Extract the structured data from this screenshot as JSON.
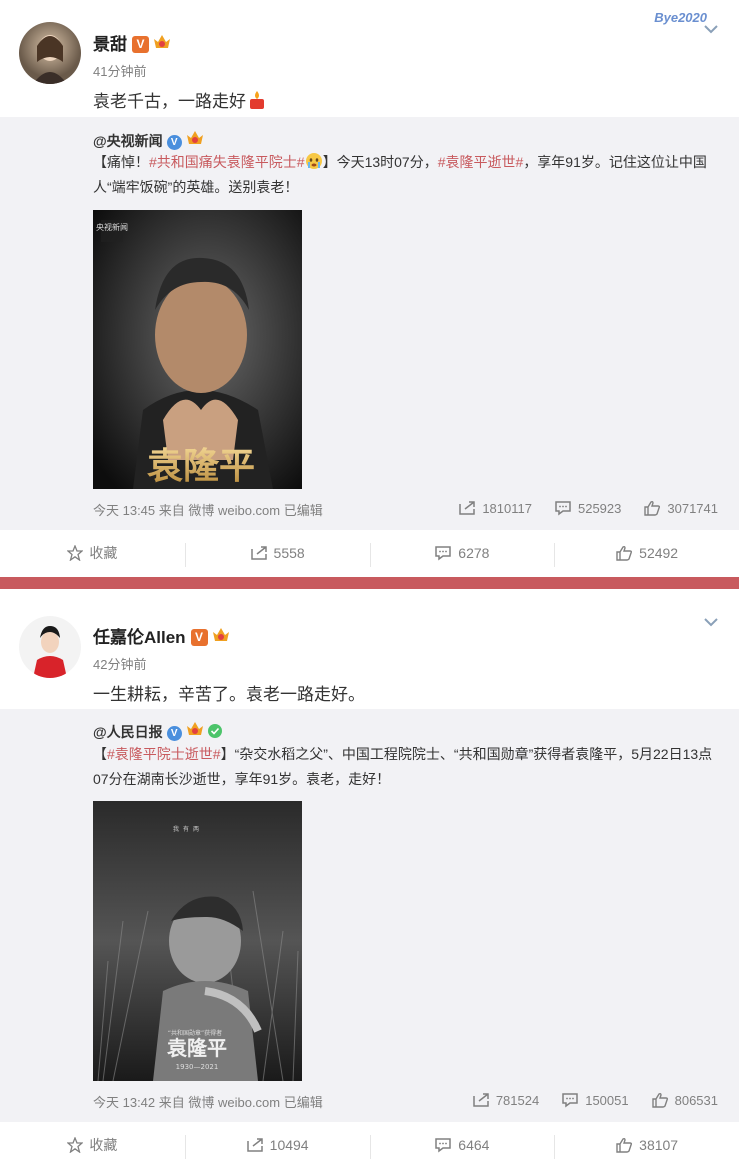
{
  "posts": [
    {
      "author": "景甜",
      "time": "41分钟前",
      "content": "袁老千古，一路走好",
      "corner_text": "Bye2020",
      "repost": {
        "author": "@央视新闻",
        "text_parts": [
          "【痛悼！",
          "#共和国痛失袁隆平院士#",
          "】今天13时07分，",
          "#袁隆平逝世#",
          "，享年91岁。记住这位让中国人“端牢饭碗”的英雄。送别袁老！"
        ],
        "image_logo": "央视新闻",
        "image_title": "袁隆平",
        "meta": "今天 13:45 来自 微博 weibo.com   已编辑",
        "reposts": "1810117",
        "comments": "525923",
        "likes": "3071741"
      },
      "actions": {
        "fav": "收藏",
        "share": "5558",
        "comment": "6278",
        "like": "52492"
      }
    },
    {
      "author": "任嘉伦Allen",
      "time": "42分钟前",
      "content": "一生耕耘，辛苦了。袁老一路走好。",
      "repost": {
        "author": "@人民日报",
        "text_parts": [
          "",
          "#袁隆平院士逝世#",
          "“杂交水稻之父”、中国工程院院士、“共和国勋章”获得者袁隆平，5月22日13点07分在湖南长沙逝世，享年91岁。袁老，走好！"
        ],
        "image_sub": "“共和国勋章”获得者",
        "image_title": "袁隆平",
        "image_years": "1930—2021",
        "meta": "今天 13:42 来自 微博 weibo.com   已编辑",
        "reposts": "781524",
        "comments": "150051",
        "likes": "806531"
      },
      "actions": {
        "fav": "收藏",
        "share": "10494",
        "comment": "6464",
        "like": "38107"
      }
    }
  ],
  "colors": {
    "separator": "#c85a5e",
    "repost_bg": "#f2f2f5",
    "topic": "#c85a5e",
    "verified": "#e8712e"
  }
}
